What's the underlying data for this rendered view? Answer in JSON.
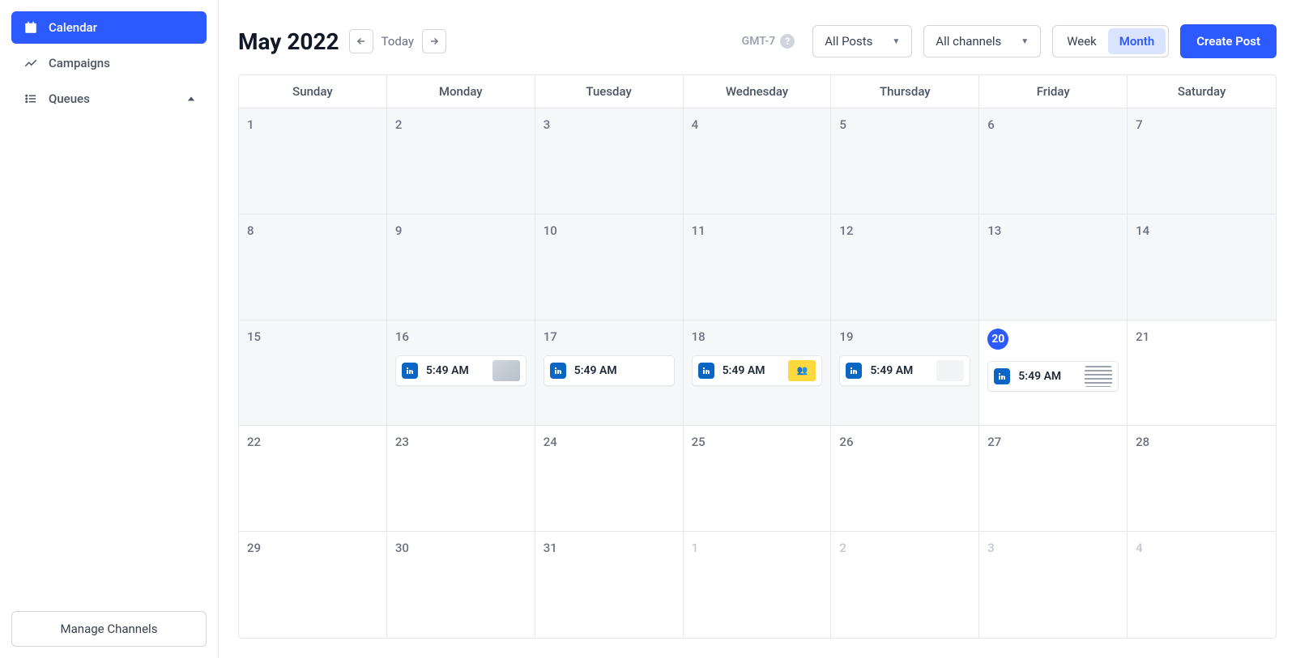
{
  "sidebar": {
    "items": [
      {
        "label": "Calendar",
        "icon": "calendar-icon"
      },
      {
        "label": "Campaigns",
        "icon": "campaigns-icon"
      },
      {
        "label": "Queues",
        "icon": "queues-icon"
      }
    ],
    "manage_label": "Manage Channels"
  },
  "header": {
    "title": "May 2022",
    "today_label": "Today",
    "timezone": "GMT-7",
    "filter_posts": "All Posts",
    "filter_channels": "All channels",
    "view_week": "Week",
    "view_month": "Month",
    "create_label": "Create Post"
  },
  "calendar": {
    "day_names": [
      "Sunday",
      "Monday",
      "Tuesday",
      "Wednesday",
      "Thursday",
      "Friday",
      "Saturday"
    ],
    "weeks": [
      [
        {
          "num": "1",
          "past": true
        },
        {
          "num": "2",
          "past": true
        },
        {
          "num": "3",
          "past": true
        },
        {
          "num": "4",
          "past": true
        },
        {
          "num": "5",
          "past": true
        },
        {
          "num": "6",
          "past": true
        },
        {
          "num": "7",
          "past": true
        }
      ],
      [
        {
          "num": "8",
          "past": true
        },
        {
          "num": "9",
          "past": true
        },
        {
          "num": "10",
          "past": true
        },
        {
          "num": "11",
          "past": true
        },
        {
          "num": "12",
          "past": true
        },
        {
          "num": "13",
          "past": true
        },
        {
          "num": "14",
          "past": true
        }
      ],
      [
        {
          "num": "15",
          "past": true
        },
        {
          "num": "16",
          "past": true,
          "event": {
            "time": "5:49 AM",
            "thumb": "thumb1"
          }
        },
        {
          "num": "17",
          "past": true,
          "event": {
            "time": "5:49 AM",
            "thumb": "thumb2"
          }
        },
        {
          "num": "18",
          "past": true,
          "event": {
            "time": "5:49 AM",
            "thumb": "thumb3"
          }
        },
        {
          "num": "19",
          "past": true,
          "event": {
            "time": "5:49 AM",
            "thumb": "thumb4"
          }
        },
        {
          "num": "20",
          "today": true,
          "event": {
            "time": "5:49 AM",
            "thumb": "thumb5"
          }
        },
        {
          "num": "21"
        }
      ],
      [
        {
          "num": "22"
        },
        {
          "num": "23"
        },
        {
          "num": "24"
        },
        {
          "num": "25"
        },
        {
          "num": "26"
        },
        {
          "num": "27"
        },
        {
          "num": "28"
        }
      ],
      [
        {
          "num": "29"
        },
        {
          "num": "30"
        },
        {
          "num": "31"
        },
        {
          "num": "1",
          "other": true
        },
        {
          "num": "2",
          "other": true
        },
        {
          "num": "3",
          "other": true
        },
        {
          "num": "4",
          "other": true
        }
      ]
    ]
  }
}
